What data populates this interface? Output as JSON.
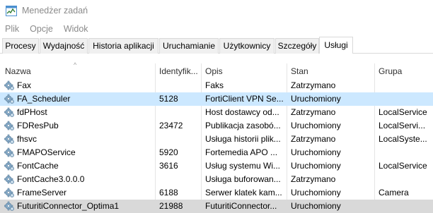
{
  "window": {
    "title": "Menedżer zadań",
    "app_icon": "task-manager-icon"
  },
  "menu": [
    "Plik",
    "Opcje",
    "Widok"
  ],
  "tabs": [
    {
      "label": "Procesy",
      "active": false
    },
    {
      "label": "Wydajność",
      "active": false
    },
    {
      "label": "Historia aplikacji",
      "active": false
    },
    {
      "label": "Uruchamianie",
      "active": false
    },
    {
      "label": "Użytkownicy",
      "active": false
    },
    {
      "label": "Szczegóły",
      "active": false
    },
    {
      "label": "Usługi",
      "active": true
    }
  ],
  "table": {
    "sort_indicator": "^",
    "columns": {
      "name": "Nazwa",
      "pid": "Identyfik...",
      "description": "Opis",
      "status": "Stan",
      "group": "Grupa"
    },
    "row_icon": "service-gear-icon",
    "rows": [
      {
        "name": "Fax",
        "pid": "",
        "description": "Faks",
        "status": "Zatrzymano",
        "group": "",
        "selected": "none"
      },
      {
        "name": "FA_Scheduler",
        "pid": "5128",
        "description": "FortiClient VPN Se...",
        "status": "Uruchomiony",
        "group": "",
        "selected": "light"
      },
      {
        "name": "fdPHost",
        "pid": "",
        "description": "Host dostawcy od...",
        "status": "Zatrzymano",
        "group": "LocalService",
        "selected": "none"
      },
      {
        "name": "FDResPub",
        "pid": "23472",
        "description": "Publikacja zasobó...",
        "status": "Uruchomiony",
        "group": "LocalServi...",
        "selected": "none"
      },
      {
        "name": "fhsvc",
        "pid": "",
        "description": "Usługa historii plik...",
        "status": "Zatrzymano",
        "group": "LocalSyste...",
        "selected": "none"
      },
      {
        "name": "FMAPOService",
        "pid": "5920",
        "description": "Fortemedia APO ...",
        "status": "Uruchomiony",
        "group": "",
        "selected": "none"
      },
      {
        "name": "FontCache",
        "pid": "3616",
        "description": "Usług systemu Wi...",
        "status": "Uruchomiony",
        "group": "LocalService",
        "selected": "none"
      },
      {
        "name": "FontCache3.0.0.0",
        "pid": "",
        "description": "Usługa buforowan...",
        "status": "Zatrzymano",
        "group": "",
        "selected": "none"
      },
      {
        "name": "FrameServer",
        "pid": "6188",
        "description": "Serwer klatek kam...",
        "status": "Uruchomiony",
        "group": "Camera",
        "selected": "none"
      },
      {
        "name": "FuturitiConnector_Optima1",
        "pid": "21988",
        "description": "FuturitiConnector...",
        "status": "Uruchomiony",
        "group": "",
        "selected": "grey"
      }
    ]
  }
}
